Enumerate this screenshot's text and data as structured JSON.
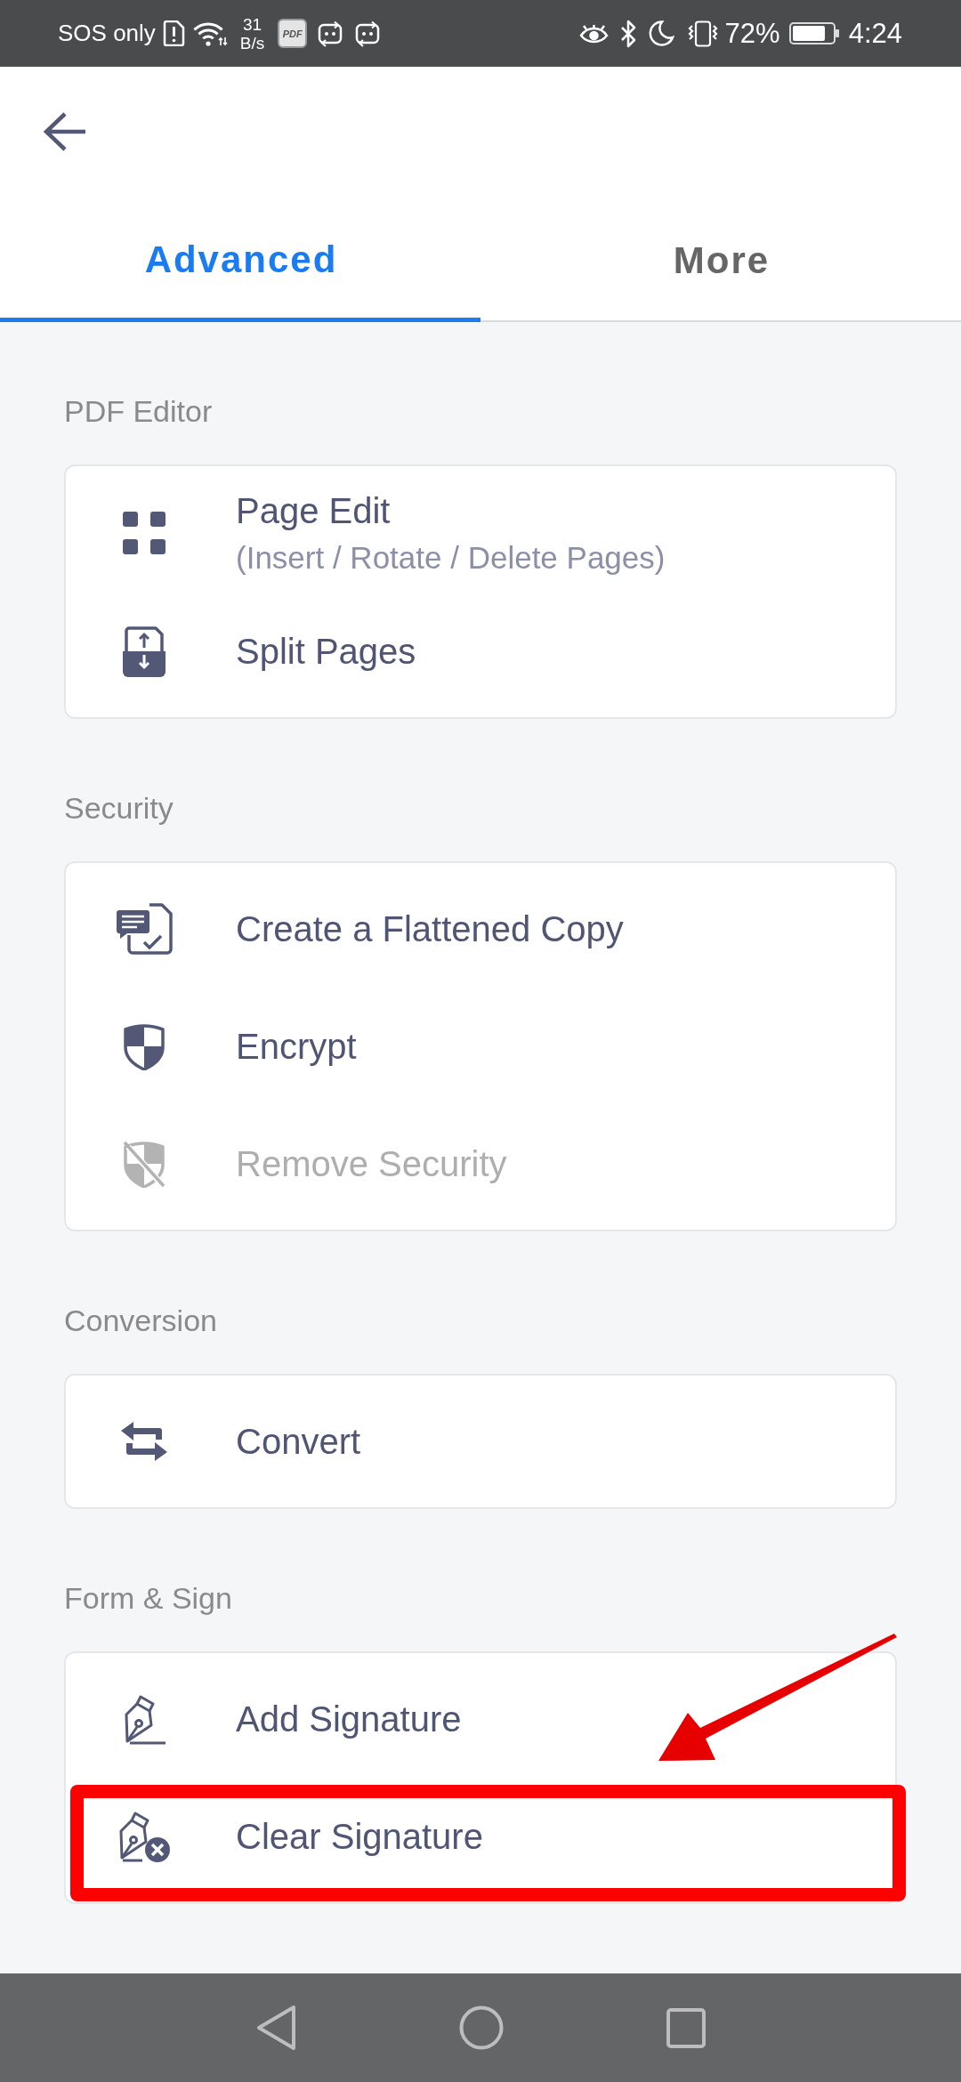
{
  "status_bar": {
    "carrier": "SOS only",
    "net_speed": {
      "value": "31",
      "unit": "B/s"
    },
    "app_badge": "PDF",
    "battery": "72%",
    "time": "4:24"
  },
  "tabs": [
    {
      "label": "Advanced",
      "selected": true
    },
    {
      "label": "More",
      "selected": false
    }
  ],
  "sections": [
    {
      "title": "PDF Editor",
      "items": [
        {
          "title": "Page Edit",
          "subtitle": "(Insert / Rotate / Delete Pages)",
          "disabled": false,
          "highlighted": false
        },
        {
          "title": "Split Pages",
          "disabled": false,
          "highlighted": false
        }
      ]
    },
    {
      "title": "Security",
      "items": [
        {
          "title": "Create a Flattened Copy",
          "disabled": false,
          "highlighted": false
        },
        {
          "title": "Encrypt",
          "disabled": false,
          "highlighted": false
        },
        {
          "title": "Remove Security",
          "disabled": true,
          "highlighted": false
        }
      ]
    },
    {
      "title": "Conversion",
      "items": [
        {
          "title": "Convert",
          "disabled": false,
          "highlighted": false
        }
      ]
    },
    {
      "title": "Form & Sign",
      "items": [
        {
          "title": "Add Signature",
          "disabled": false,
          "highlighted": false
        },
        {
          "title": "Clear Signature",
          "disabled": false,
          "highlighted": true
        }
      ]
    }
  ]
}
